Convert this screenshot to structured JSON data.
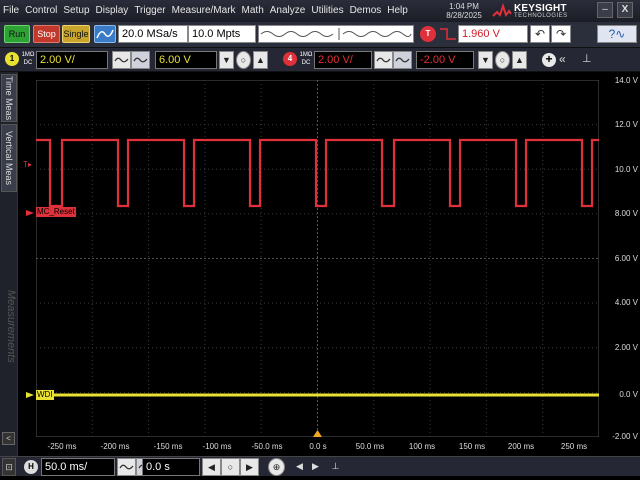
{
  "menu": {
    "items": [
      "File",
      "Control",
      "Setup",
      "Display",
      "Trigger",
      "Measure/Mark",
      "Math",
      "Analyze",
      "Utilities",
      "Demos",
      "Help"
    ],
    "time": "1:04 PM",
    "date": "8/28/2025",
    "brand": "KEYSIGHT",
    "brand_sub": "TECHNOLOGIES",
    "minimize": "–",
    "close": "X"
  },
  "toolbar": {
    "run_label": "Run",
    "stop_label": "Stop",
    "single_label": "Single",
    "sample_rate": "20.0 MSa/s",
    "memory_depth": "10.0 Mpts",
    "trigger_icon": "T",
    "trigger_level": "1.960 V",
    "undo": "↶",
    "redo": "↷",
    "help_icon": "?∿"
  },
  "channels": [
    {
      "num": "1",
      "coupling_top": "1MΩ",
      "coupling_bottom": "DC",
      "scale": "2.00 V/",
      "offset": "6.00 V",
      "color": "#e8e033"
    },
    {
      "num": "4",
      "coupling_top": "1MΩ",
      "coupling_bottom": "DC",
      "scale": "2.00 V/",
      "offset": "-2.00 V",
      "color": "#e0303a"
    }
  ],
  "side_tabs": {
    "time_meas": "Time Meas",
    "vertical_meas": "Vertical Meas",
    "measurements": "Measurements",
    "collapse": "<"
  },
  "y_axis": [
    "14.0 V",
    "12.0 V",
    "10.0 V",
    "8.00 V",
    "6.00 V",
    "4.00 V",
    "2.00 V",
    "0.0 V",
    "-2.00 V"
  ],
  "x_axis": [
    "-250 ms",
    "-200 ms",
    "-150 ms",
    "-100 ms",
    "-50.0 ms",
    "0.0 s",
    "50.0 ms",
    "100 ms",
    "150 ms",
    "200 ms",
    "250 ms"
  ],
  "traces": {
    "ch4_label": "MC_Reset",
    "ch1_label": "WDI",
    "ch4_color": "#e0303a",
    "ch1_color": "#e8e033"
  },
  "horizontal": {
    "icon": "H",
    "scale": "50.0 ms/",
    "position": "0.0 s"
  }
}
